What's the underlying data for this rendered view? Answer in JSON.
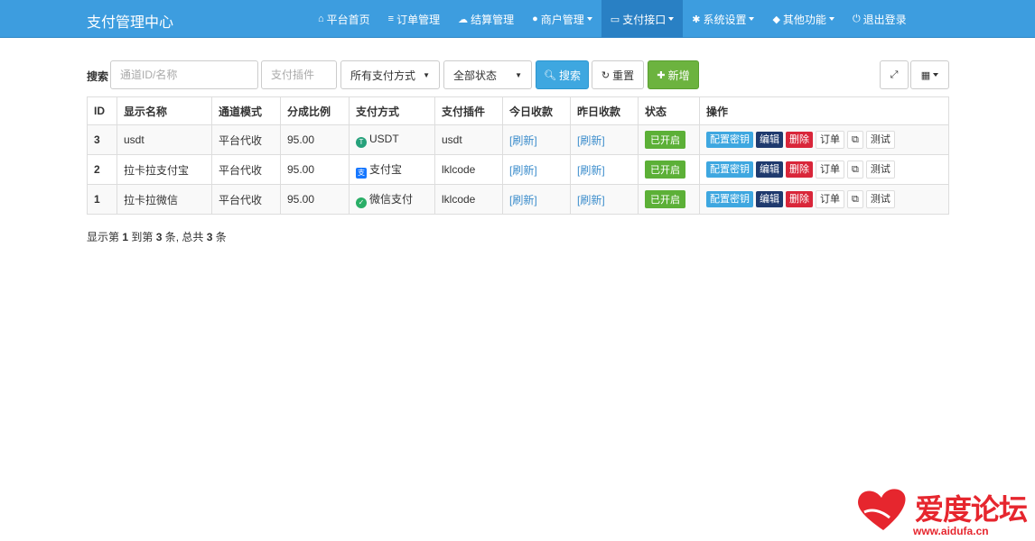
{
  "app": {
    "title": "支付管理中心"
  },
  "nav": [
    {
      "label": "平台首页",
      "icon": "home-icon",
      "glyph": "⌂",
      "dropdown": false,
      "active": false
    },
    {
      "label": "订单管理",
      "icon": "list-icon",
      "glyph": "≡",
      "dropdown": false,
      "active": false
    },
    {
      "label": "结算管理",
      "icon": "cloud-icon",
      "glyph": "☁",
      "dropdown": false,
      "active": false
    },
    {
      "label": "商户管理",
      "icon": "user-icon",
      "glyph": "●",
      "dropdown": true,
      "active": false
    },
    {
      "label": "支付接口",
      "icon": "credit-card-icon",
      "glyph": "▭",
      "dropdown": true,
      "active": true
    },
    {
      "label": "系统设置",
      "icon": "gear-icon",
      "glyph": "✱",
      "dropdown": true,
      "active": false
    },
    {
      "label": "其他功能",
      "icon": "cube-icon",
      "glyph": "◆",
      "dropdown": true,
      "active": false
    },
    {
      "label": "退出登录",
      "icon": "power-icon",
      "glyph": "⏻",
      "dropdown": false,
      "active": false
    }
  ],
  "toolbar": {
    "search_label": "搜索",
    "channel_placeholder": "通道ID/名称",
    "plugin_placeholder": "支付插件",
    "pay_type_selected": "所有支付方式",
    "status_selected": "全部状态",
    "search_button": "搜索",
    "reset_button": "重置",
    "add_button": "新增"
  },
  "table": {
    "headers": [
      "ID",
      "显示名称",
      "通道模式",
      "分成比例",
      "支付方式",
      "支付插件",
      "今日收款",
      "昨日收款",
      "状态",
      "操作"
    ],
    "rows": [
      {
        "id": "3",
        "name": "usdt",
        "mode": "平台代收",
        "ratio": "95.00",
        "pay_type": "USDT",
        "pay_icon": "usdt-icon",
        "plugin": "usdt",
        "today": "[刷新]",
        "yesterday": "[刷新]",
        "status": "已开启"
      },
      {
        "id": "2",
        "name": "拉卡拉支付宝",
        "mode": "平台代收",
        "ratio": "95.00",
        "pay_type": "支付宝",
        "pay_icon": "alipay-icon",
        "plugin": "lklcode",
        "today": "[刷新]",
        "yesterday": "[刷新]",
        "status": "已开启"
      },
      {
        "id": "1",
        "name": "拉卡拉微信",
        "mode": "平台代收",
        "ratio": "95.00",
        "pay_type": "微信支付",
        "pay_icon": "wechat-icon",
        "plugin": "lklcode",
        "today": "[刷新]",
        "yesterday": "[刷新]",
        "status": "已开启"
      }
    ],
    "actions": {
      "config_key": "配置密钥",
      "edit": "编辑",
      "delete": "删除",
      "order": "订单",
      "copy_glyph": "⧉",
      "test": "测试"
    }
  },
  "summary": {
    "prefix": "显示第 ",
    "from": "1",
    "mid1": " 到第 ",
    "to": "3",
    "mid2": " 条, 总共 ",
    "total": "3",
    "suffix": " 条"
  },
  "watermark": {
    "text": "爱度论坛",
    "url": "www.aidufa.cn"
  },
  "colors": {
    "navbar": "#3d9ddf",
    "nav_active": "#2980c4",
    "status_on": "#5cb037",
    "delete": "#d9263a",
    "edit": "#1f3a6e",
    "accent": "#3ea7e0"
  }
}
